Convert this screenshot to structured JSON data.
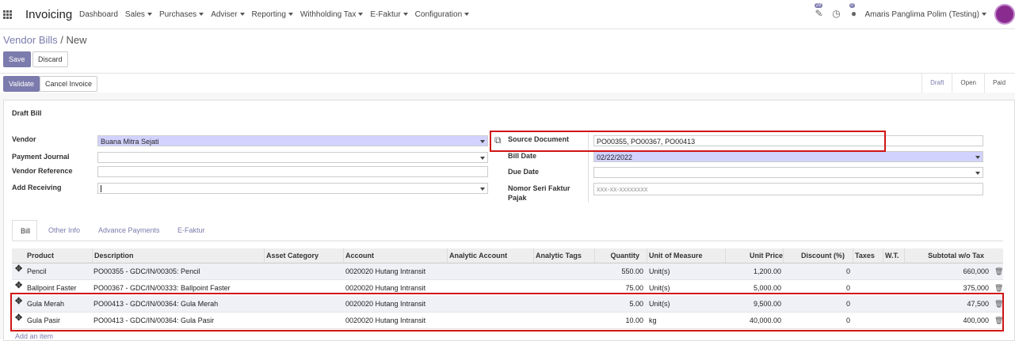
{
  "app": {
    "name": "Invoicing"
  },
  "menu": [
    {
      "label": "Dashboard",
      "has_caret": false
    },
    {
      "label": "Sales",
      "has_caret": true
    },
    {
      "label": "Purchases",
      "has_caret": true
    },
    {
      "label": "Adviser",
      "has_caret": true
    },
    {
      "label": "Reporting",
      "has_caret": true
    },
    {
      "label": "Withholding Tax",
      "has_caret": true
    },
    {
      "label": "E-Faktur",
      "has_caret": true
    },
    {
      "label": "Configuration",
      "has_caret": true
    }
  ],
  "topbar": {
    "activity_badge": "29",
    "messages_badge": "0",
    "user": "Amaris Panglima Polim (Testing)"
  },
  "breadcrumb": {
    "parent": "Vendor Bills",
    "separator": "/",
    "current": "New"
  },
  "buttons": {
    "save": "Save",
    "discard": "Discard",
    "validate": "Validate",
    "cancel_invoice": "Cancel Invoice"
  },
  "status_steps": [
    {
      "label": "Draft",
      "active": true
    },
    {
      "label": "Open",
      "active": false
    },
    {
      "label": "Paid",
      "active": false
    }
  ],
  "form": {
    "title": "Draft Bill",
    "vendor": {
      "label": "Vendor",
      "value": "Buana Mitra Sejati"
    },
    "payment_journal": {
      "label": "Payment Journal",
      "value": ""
    },
    "vendor_reference": {
      "label": "Vendor Reference",
      "value": ""
    },
    "add_receiving": {
      "label": "Add Receiving",
      "value": ""
    },
    "source_document": {
      "label": "Source Document",
      "value": "PO00355, PO00367, PO00413"
    },
    "bill_date": {
      "label": "Bill Date",
      "value": "02/22/2022"
    },
    "due_date": {
      "label": "Due Date",
      "value": ""
    },
    "nomor_seri": {
      "label_line1": "Nomor Seri Faktur",
      "label_line2": "Pajak",
      "placeholder": "xxx-xx-xxxxxxxx"
    }
  },
  "tabs": [
    {
      "label": "Bill",
      "active": true
    },
    {
      "label": "Other Info",
      "active": false
    },
    {
      "label": "Advance Payments",
      "active": false
    },
    {
      "label": "E-Faktur",
      "active": false
    }
  ],
  "table": {
    "columns": [
      "Product",
      "Description",
      "Asset Category",
      "Account",
      "Analytic Account",
      "Analytic Tags",
      "Quantity",
      "Unit of Measure",
      "Unit Price",
      "Discount (%)",
      "Taxes",
      "W.T.",
      "Subtotal w/o Tax"
    ],
    "rows": [
      {
        "product": "Pencil",
        "description": "PO00355 - GDC/IN/00305: Pencil",
        "account": "0020020 Hutang Intransit",
        "quantity": "550.00",
        "uom": "Unit(s)",
        "unit_price": "1,200.00",
        "discount": "0",
        "subtotal": "660,000"
      },
      {
        "product": "Ballpoint Faster",
        "description": "PO00367 - GDC/IN/00333: Ballpoint Faster",
        "account": "0020020 Hutang Intransit",
        "quantity": "75.00",
        "uom": "Unit(s)",
        "unit_price": "5,000.00",
        "discount": "0",
        "subtotal": "375,000"
      },
      {
        "product": "Gula Merah",
        "description": "PO00413 - GDC/IN/00364: Gula Merah",
        "account": "0020020 Hutang Intransit",
        "quantity": "5.00",
        "uom": "Unit(s)",
        "unit_price": "9,500.00",
        "discount": "0",
        "subtotal": "47,500"
      },
      {
        "product": "Gula Pasir",
        "description": "PO00413 - GDC/IN/00364: Gula Pasir",
        "account": "0020020 Hutang Intransit",
        "quantity": "10.00",
        "uom": "kg",
        "unit_price": "40,000.00",
        "discount": "0",
        "subtotal": "400,000"
      }
    ],
    "add_item": "Add an item"
  },
  "colors": {
    "accent": "#7c7bad",
    "required_bg": "#d2d2ff",
    "highlight": "#d01515"
  }
}
